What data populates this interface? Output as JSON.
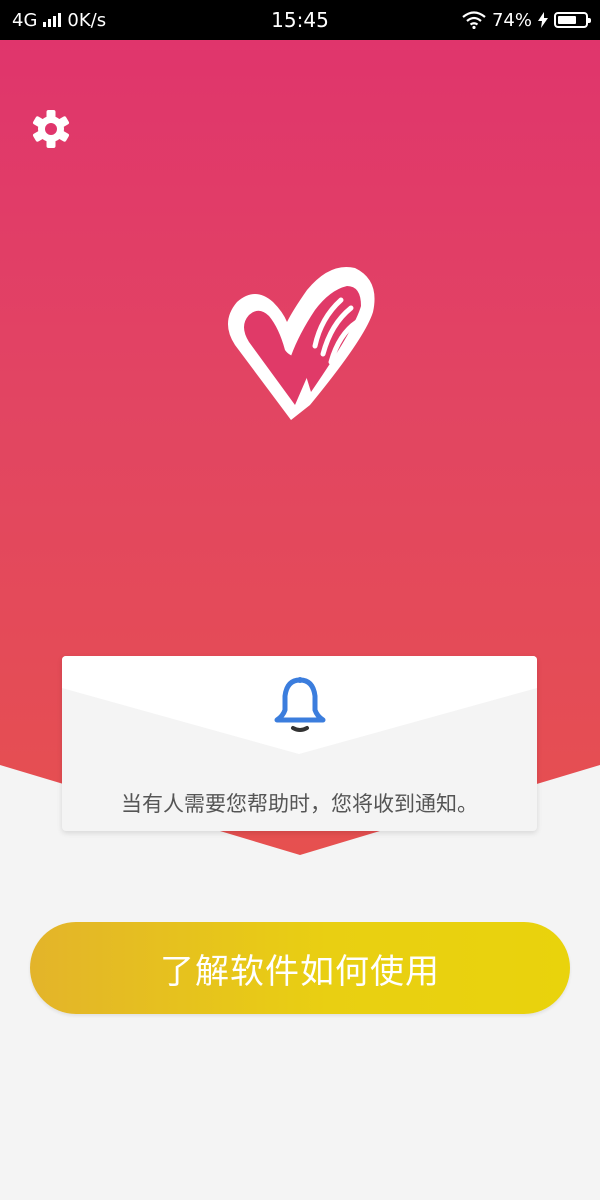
{
  "status_bar": {
    "network": "4G",
    "speed": "0K/s",
    "time": "15:45",
    "battery_percent": "74%",
    "battery_level": 0.74,
    "icons": [
      "signal-icon",
      "wifi-icon",
      "charging-icon",
      "battery-icon"
    ]
  },
  "header": {
    "settings_icon": "gear-icon",
    "logo_icon": "heart-hand-logo"
  },
  "notification_card": {
    "icon": "bell-icon",
    "message": "当有人需要您帮助时，您将收到通知。"
  },
  "cta": {
    "label": "了解软件如何使用"
  },
  "colors": {
    "hero_top": "#e0356c",
    "hero_bottom": "#e6504f",
    "bell_blue": "#3b7ddd",
    "button_yellow": "#e9cf12",
    "background": "#f4f4f4"
  }
}
